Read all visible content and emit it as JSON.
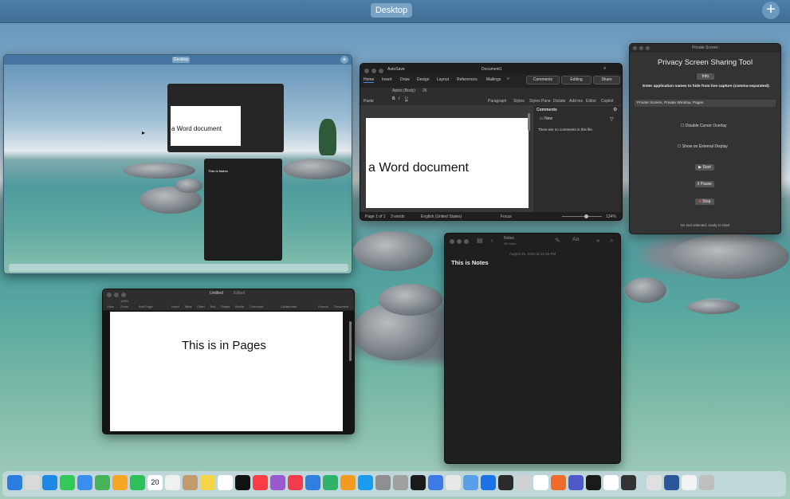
{
  "spaces": {
    "desktop_label": "Desktop",
    "add_space_icon": "plus-icon"
  },
  "mini_desktop": {
    "label": "Desktop",
    "word_text": "a Word document",
    "notes_text": "This is Notes"
  },
  "word": {
    "autosave": "AutoSave",
    "doc_title": "Document1",
    "comments_btn": "Comments",
    "editing_btn": "Editing",
    "share_btn": "Share",
    "tabs": [
      "Home",
      "Insert",
      "Draw",
      "Design",
      "Layout",
      "References",
      "Mailings"
    ],
    "font_name": "Aptos (Body)",
    "font_size": "26",
    "tool_groups": [
      "Paste",
      "Paragraph",
      "Styles",
      "Styles Pane",
      "Dictate",
      "Add-ins",
      "Editor",
      "Copilot"
    ],
    "document_text": "a Word document",
    "comments_title": "Comments",
    "new_label": "New",
    "no_comments": "There are no comments in this file.",
    "status_page": "Page 1 of 1",
    "status_words": "3 words",
    "status_lang": "English (United States)",
    "status_focus": "Focus",
    "zoom": "134%"
  },
  "privacy": {
    "titlebar": "Private Screen",
    "title": "Privacy Screen Sharing Tool",
    "info_btn": "Info",
    "prompt": "Enter application names to hide from live capture (comma-separated):",
    "apps_value": "Private Screen, Private Window, Pages",
    "disable_cursor": "Disable Cursor Overlay",
    "show_external": "Show on External Display",
    "start_btn": "Start",
    "pause_btn": "Pause",
    "stop_btn": "Stop",
    "footer": "No tool selected, ready to Start"
  },
  "notes": {
    "folder": "Notes",
    "folder_sub": "28 notes",
    "date": "August 26, 2024 at 12:19 PM",
    "body": "This is Notes"
  },
  "pages": {
    "title": "Untitled",
    "status": "Edited",
    "toolbar": [
      "View",
      "Zoom",
      "Add Page",
      "Insert",
      "Table",
      "Chart",
      "Text",
      "Shape",
      "Media",
      "Comment",
      "Collaborate",
      "Format",
      "Document"
    ],
    "zoom": "125%",
    "body": "This is in Pages"
  },
  "dock": {
    "calendar_date": "20",
    "icons": [
      "finder-icon",
      "launchpad-icon",
      "safari-icon",
      "messages-icon",
      "mail-icon",
      "maps-icon",
      "photos-icon",
      "facetime-icon",
      "calendar-icon",
      "reminders-icon",
      "contacts-icon",
      "notes-icon",
      "freeform-icon",
      "tv-icon",
      "music-icon",
      "podcasts-icon",
      "news-icon",
      "keynote-icon",
      "numbers-icon",
      "pages-icon",
      "app-store-icon",
      "settings-icon",
      "font-book-icon",
      "terminal-icon",
      "preview-icon",
      "chrome-icon",
      "finder2-icon",
      "xcode-icon",
      "shell-icon",
      "screenshot-icon",
      "compass-icon",
      "lasso-icon",
      "teams-icon",
      "quicktime-icon",
      "chatgpt-icon",
      "lock-icon",
      "pen-icon",
      "word-icon",
      "document-icon",
      "trash-icon"
    ],
    "colors": [
      "#2a7de1",
      "#d9d9d9",
      "#1e88e5",
      "#34c759",
      "#3b8ef0",
      "#46b35a",
      "#f6a623",
      "#2fbf5a",
      "#ffffff",
      "#f0f0f0",
      "#c29a6b",
      "#f5d547",
      "#ffffff",
      "#111111",
      "#fc3c44",
      "#9b59d0",
      "#f23c4e",
      "#2f7fe0",
      "#2fb36b",
      "#f29c1f",
      "#1a9bf0",
      "#8e8e93",
      "#a0a0a0",
      "#1a1a1a",
      "#3d7ae8",
      "#e8e8e8",
      "#5aa0e8",
      "#1a73e8",
      "#2b2b2b",
      "#d0d0d0",
      "#ffffff",
      "#f06a2a",
      "#5059c9",
      "#1a1a1a",
      "#ffffff",
      "#333333",
      "#e0e0e0",
      "#2b579a",
      "#f2f2f2",
      "#bfbfbf"
    ]
  }
}
